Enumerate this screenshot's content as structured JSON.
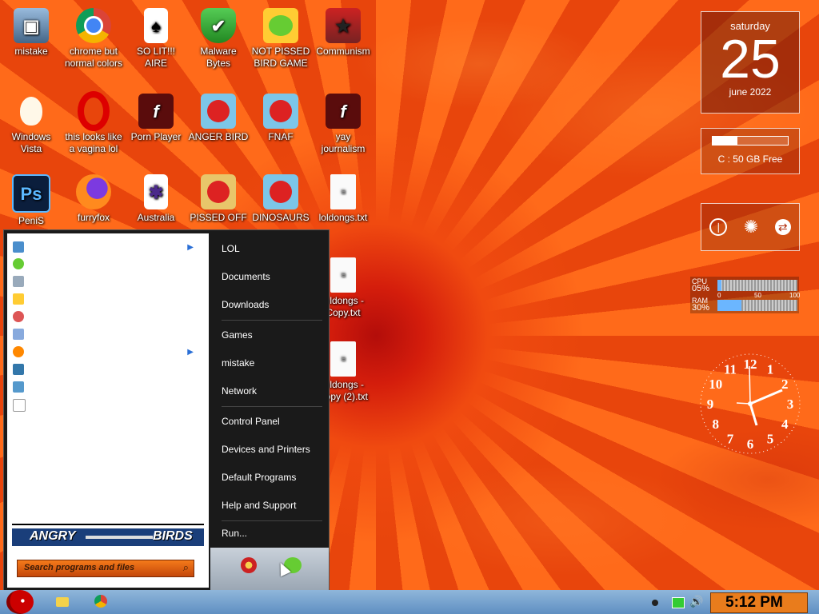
{
  "desktop_icons": [
    {
      "label": "mistake"
    },
    {
      "label": "chrome but normal colors"
    },
    {
      "label": "SO LIT!!! AIRE"
    },
    {
      "label": "Malware Bytes"
    },
    {
      "label": "NOT PISSED BIRD GAME"
    },
    {
      "label": "Communism"
    },
    {
      "label": "Windows Vista"
    },
    {
      "label": "this looks like a vagina lol"
    },
    {
      "label": "Porn Player"
    },
    {
      "label": "ANGER BIRD"
    },
    {
      "label": "FNAF"
    },
    {
      "label": "yay journalism"
    },
    {
      "label": "PeniS"
    },
    {
      "label": "furryfox"
    },
    {
      "label": "Australia"
    },
    {
      "label": "PISSED OFF"
    },
    {
      "label": "DINOSAURS"
    },
    {
      "label": "loldongs.txt"
    },
    {
      "label": "loldongs - Copy.txt"
    },
    {
      "label": "loldongs - Copy (2).txt"
    }
  ],
  "calendar": {
    "weekday": "saturday",
    "day": "25",
    "month_year": "june 2022"
  },
  "drive": {
    "label": "C : 50 GB Free"
  },
  "meters": {
    "cpu_label": "CPU",
    "cpu_value": "05%",
    "ram_label": "RAM",
    "ram_value": "30%",
    "scale": [
      "0",
      "50",
      "100"
    ]
  },
  "clock_face": [
    "12",
    "1",
    "2",
    "3",
    "4",
    "5",
    "6",
    "7",
    "8",
    "9",
    "10",
    "11"
  ],
  "start_menu": {
    "right_items": [
      "LOL",
      "Documents",
      "Downloads",
      "Games",
      "mistake",
      "Network",
      "Control Panel",
      "Devices and Printers",
      "Default Programs",
      "Help and Support",
      "Run..."
    ],
    "banner_left": "ANGRY",
    "banner_right": "BIRDS",
    "search_placeholder": "Search programs and files"
  },
  "taskbar": {
    "time": "5:12 PM"
  }
}
